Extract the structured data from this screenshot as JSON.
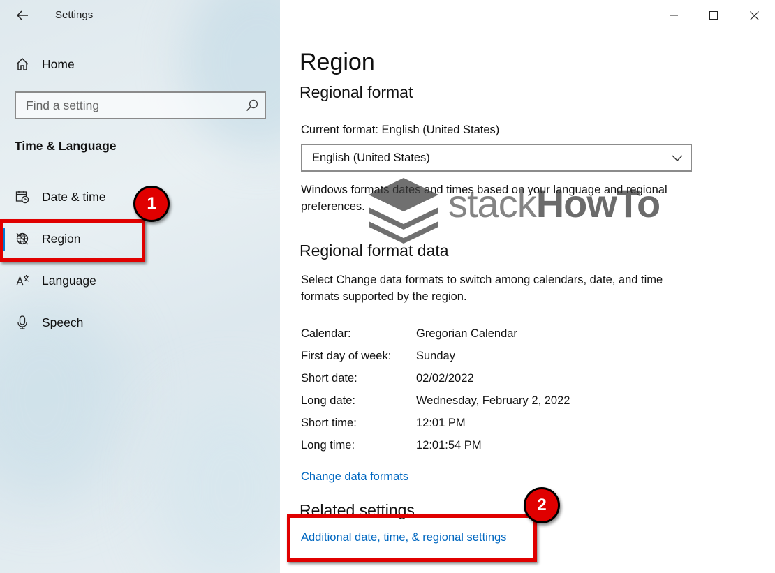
{
  "window": {
    "app_title": "Settings",
    "controls": {
      "minimize": "minimize-icon",
      "maximize": "maximize-icon",
      "close": "close-icon"
    }
  },
  "sidebar": {
    "home_label": "Home",
    "search_placeholder": "Find a setting",
    "section_title": "Time & Language",
    "items": [
      {
        "label": "Date & time",
        "icon": "calendar-clock-icon"
      },
      {
        "label": "Region",
        "icon": "globe-icon",
        "selected": true
      },
      {
        "label": "Language",
        "icon": "language-icon"
      },
      {
        "label": "Speech",
        "icon": "microphone-icon"
      }
    ]
  },
  "main": {
    "page_title": "Region",
    "regional_format": {
      "heading": "Regional format",
      "current_label": "Current format: English (United States)",
      "dropdown_value": "English (United States)",
      "description_line1": "Windows formats dates and times based on your language and regional",
      "description_line2": "preferences."
    },
    "format_data": {
      "heading": "Regional format data",
      "description_line1": "Select Change data formats to switch among calendars, date, and time",
      "description_line2": "formats supported by the region.",
      "rows": [
        {
          "label": "Calendar:",
          "value": "Gregorian Calendar"
        },
        {
          "label": "First day of week:",
          "value": "Sunday"
        },
        {
          "label": "Short date:",
          "value": "02/02/2022"
        },
        {
          "label": "Long date:",
          "value": "Wednesday, February 2, 2022"
        },
        {
          "label": "Short time:",
          "value": "12:01 PM"
        },
        {
          "label": "Long time:",
          "value": "12:01:54 PM"
        }
      ],
      "change_link": "Change data formats"
    },
    "related": {
      "heading": "Related settings",
      "link": "Additional date, time, & regional settings"
    }
  },
  "watermark": {
    "light": "stack",
    "bold": "HowTo"
  },
  "annotations": {
    "badge1": "1",
    "badge2": "2",
    "color": "#e00000"
  },
  "colors": {
    "accent": "#0078d4",
    "link": "#0067c0"
  }
}
